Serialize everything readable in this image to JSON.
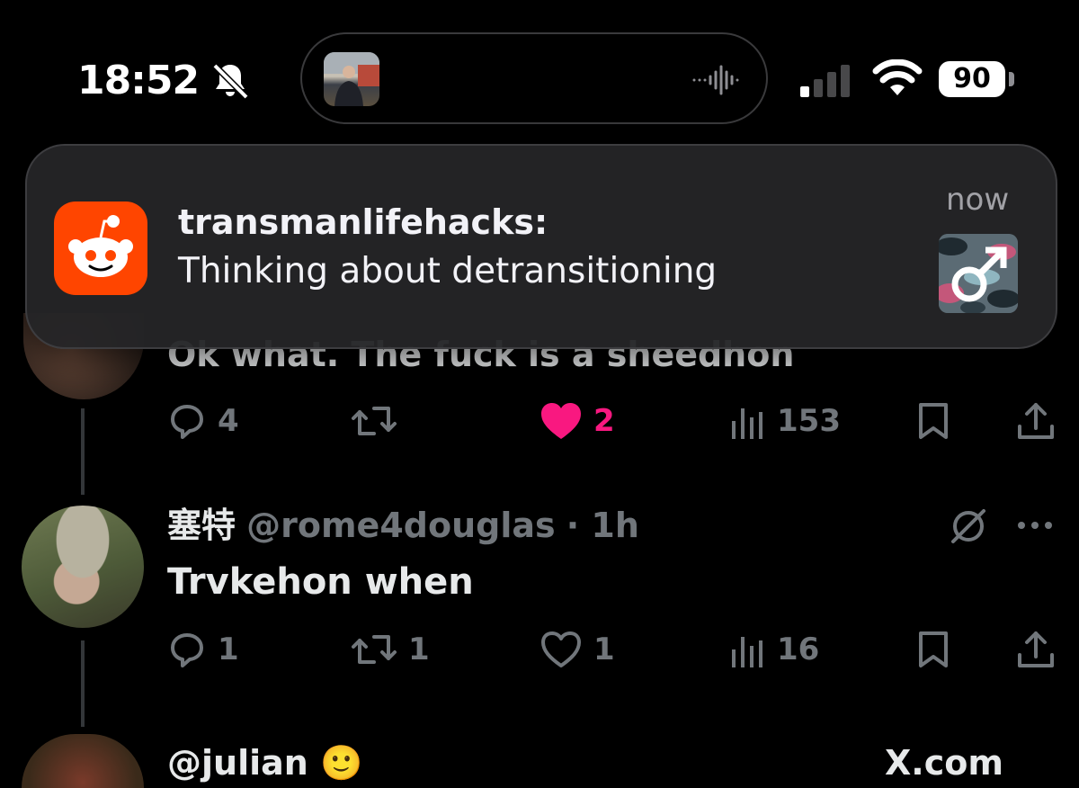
{
  "status_bar": {
    "time": "18:52",
    "battery": "90"
  },
  "notification": {
    "app_icon": "reddit-icon",
    "title": "transmanlifehacks:",
    "body": "Thinking about detransitioning",
    "time": "now",
    "thumbnail_icon": "male-symbol-icon"
  },
  "tweets": [
    {
      "text": "Ok what. The fuck is a sheedhon",
      "replies": "4",
      "retweets": "",
      "likes": "2",
      "liked": true,
      "views": "153"
    },
    {
      "display_name": "塞特",
      "handle": "@rome4douglas",
      "time": "· 1h",
      "text": "Trvkehon when",
      "replies": "1",
      "retweets": "1",
      "likes": "1",
      "liked": false,
      "views": "16"
    },
    {
      "display_name": "@julian 🙂",
      "right_label": "X.com"
    }
  ],
  "colors": {
    "background": "#000000",
    "like_pink": "#f91880",
    "muted": "#71767b",
    "reddit_orange": "#ff4500"
  }
}
